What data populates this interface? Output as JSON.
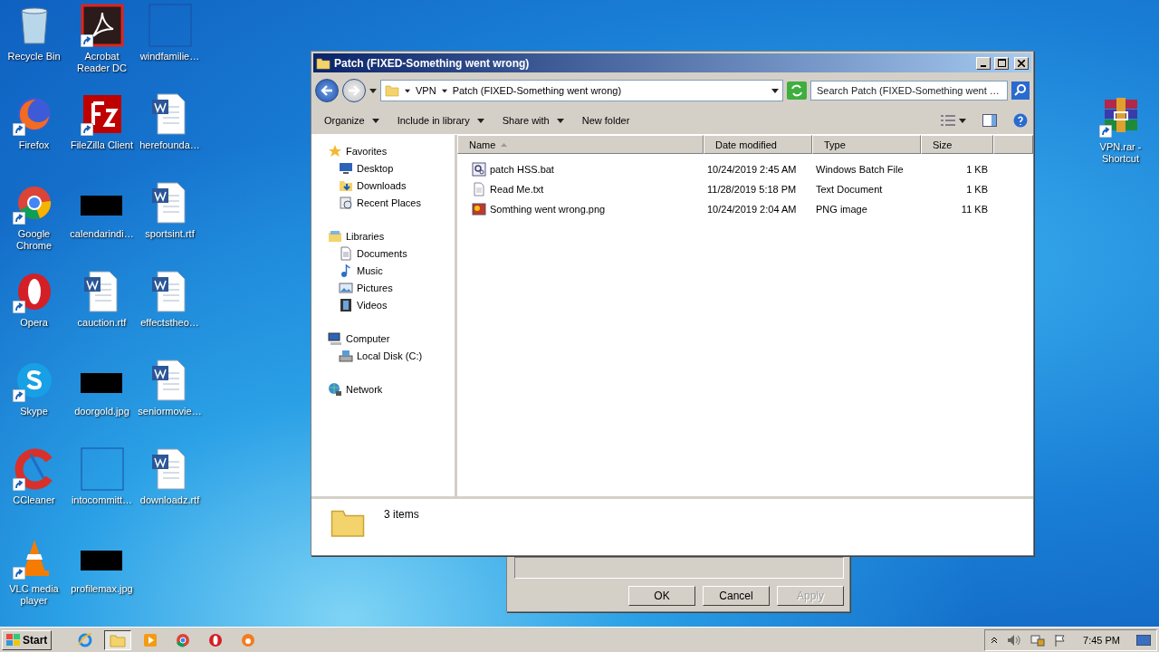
{
  "desktop_icons": [
    {
      "label": "Recycle Bin",
      "kind": "recycle",
      "shortcut": false
    },
    {
      "label": "Firefox",
      "kind": "firefox",
      "shortcut": true
    },
    {
      "label": "Google Chrome",
      "kind": "chrome",
      "shortcut": true
    },
    {
      "label": "Opera",
      "kind": "opera",
      "shortcut": true
    },
    {
      "label": "Skype",
      "kind": "skype",
      "shortcut": true
    },
    {
      "label": "CCleaner",
      "kind": "ccleaner",
      "shortcut": true
    },
    {
      "label": "VLC media player",
      "kind": "vlc",
      "shortcut": true
    },
    {
      "label": "Acrobat Reader DC",
      "kind": "acrobat",
      "shortcut": true
    },
    {
      "label": "FileZilla Client",
      "kind": "filezilla",
      "shortcut": true
    },
    {
      "label": "calendarindi…",
      "kind": "black",
      "shortcut": false
    },
    {
      "label": "cauction.rtf",
      "kind": "word",
      "shortcut": false
    },
    {
      "label": "doorgold.jpg",
      "kind": "black",
      "shortcut": false
    },
    {
      "label": "intocommitt…",
      "kind": "blank",
      "shortcut": false
    },
    {
      "label": "profilemax.jpg",
      "kind": "black",
      "shortcut": false
    },
    {
      "label": "windfamilie…",
      "kind": "blank",
      "shortcut": false
    },
    {
      "label": "herefounda…",
      "kind": "word",
      "shortcut": false
    },
    {
      "label": "sportsint.rtf",
      "kind": "word",
      "shortcut": false
    },
    {
      "label": "effectstheo…",
      "kind": "word",
      "shortcut": false
    },
    {
      "label": "seniormovie…",
      "kind": "word",
      "shortcut": false
    },
    {
      "label": "downloadz.rtf",
      "kind": "word",
      "shortcut": false
    }
  ],
  "right_icon": {
    "label": "VPN.rar - Shortcut",
    "kind": "winrar",
    "shortcut": true
  },
  "explorer": {
    "title": "Patch (FIXED-Something went wrong)",
    "address": [
      "VPN",
      "Patch (FIXED-Something went wrong)"
    ],
    "search": {
      "placeholder": "Search Patch (FIXED-Something went …"
    },
    "toolbar": [
      {
        "label": "Organize",
        "menu": true
      },
      {
        "label": "Include in library",
        "menu": true
      },
      {
        "label": "Share with",
        "menu": true
      },
      {
        "label": "New folder",
        "menu": false
      }
    ],
    "nav": [
      {
        "label": "Favorites",
        "kind": "star",
        "children": [
          {
            "label": "Desktop",
            "kind": "desktop"
          },
          {
            "label": "Downloads",
            "kind": "downloads"
          },
          {
            "label": "Recent Places",
            "kind": "recent"
          }
        ]
      },
      {
        "label": "Libraries",
        "kind": "libraries",
        "children": [
          {
            "label": "Documents",
            "kind": "documents"
          },
          {
            "label": "Music",
            "kind": "music"
          },
          {
            "label": "Pictures",
            "kind": "pictures"
          },
          {
            "label": "Videos",
            "kind": "videos"
          }
        ]
      },
      {
        "label": "Computer",
        "kind": "computer",
        "children": [
          {
            "label": "Local Disk (C:)",
            "kind": "disk"
          }
        ]
      },
      {
        "label": "Network",
        "kind": "network"
      }
    ],
    "columns": [
      {
        "label": "Name",
        "sorted": true
      },
      {
        "label": "Date modified",
        "sorted": false
      },
      {
        "label": "Type",
        "sorted": false
      },
      {
        "label": "Size",
        "sorted": false
      }
    ],
    "rows": [
      {
        "name": "patch HSS.bat",
        "kind": "bat",
        "date": "10/24/2019 2:45 AM",
        "type": "Windows Batch File",
        "size": "1 KB"
      },
      {
        "name": "Read Me.txt",
        "kind": "txt",
        "date": "11/28/2019 5:18 PM",
        "type": "Text Document",
        "size": "1 KB"
      },
      {
        "name": "Somthing went wrong.png",
        "kind": "png",
        "date": "10/24/2019 2:04 AM",
        "type": "PNG image",
        "size": "11 KB"
      }
    ],
    "status": "3 items"
  },
  "dialog": {
    "buttons": [
      {
        "label": "OK",
        "disabled": false
      },
      {
        "label": "Cancel",
        "disabled": false
      },
      {
        "label": "Apply",
        "disabled": true
      }
    ]
  },
  "taskbar": {
    "start": "Start",
    "apps": [
      {
        "kind": "ie",
        "selected": false
      },
      {
        "kind": "explorer",
        "selected": true
      },
      {
        "kind": "media",
        "selected": false
      },
      {
        "kind": "chrome",
        "selected": false
      },
      {
        "kind": "opera",
        "selected": false
      },
      {
        "kind": "avast",
        "selected": false
      }
    ],
    "clock": "7:45 PM"
  }
}
